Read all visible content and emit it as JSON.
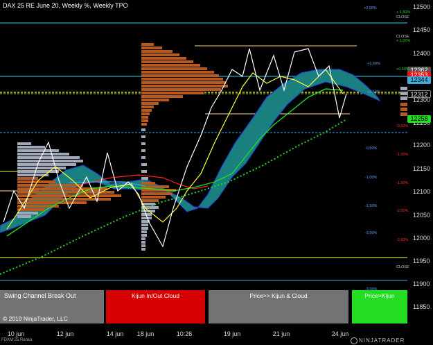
{
  "title": "DAX 25 RE June 20, Weekly %, Weekly TPO",
  "y_axis": {
    "ticks": [
      "12500",
      "12450",
      "12400",
      "12350",
      "12300",
      "12250",
      "12200",
      "12150",
      "12100",
      "12050",
      "12000",
      "11950",
      "11900",
      "11850"
    ]
  },
  "x_axis": {
    "ticks": [
      "10 jun",
      "12 jun",
      "14 jun",
      "18 jun",
      "10:26",
      "19 jun",
      "21 jun",
      "24 jun"
    ]
  },
  "price_labels": {
    "red": "12353",
    "blue": "12344",
    "last": "12312",
    "green": "12258",
    "dark": "12362"
  },
  "pct_labels": {
    "p200": "+2,00%",
    "p150": "+ 1,50%",
    "close1": "CLOSE",
    "close2": "CLOSE",
    "p100a": "+ 1,00%",
    "p100b": "+1,00%",
    "p050a": "+0,50%",
    "p050b": "+0,50%",
    "m050a": "-0,50%",
    "m050b": "-0,50%",
    "m100a": "-1,00%",
    "m100b": "-1,00%",
    "m150a": "-1,50%",
    "m150b": "-1,50%",
    "m200a": "-2,00%",
    "m200b": "-2,00%",
    "m250": "-2,50%",
    "close3": "CLOSE",
    "m300": "-3,00%"
  },
  "panels": {
    "swing": "Swing Channel Break Out",
    "kijun": "Kijun In/Out Cloud",
    "price_kijun_cloud": "Price>> Kijun & Cloud",
    "price_kijun": "Price>Kijun"
  },
  "copyright": "© 2019 NinjaTrader, LLC",
  "footer_note": "FDXM 25 Renko",
  "brand": "NINJATRADER",
  "colors": {
    "background": "#000000",
    "cloud": "#1a7f7f",
    "tpo_orange": "#b85a1e",
    "tpo_gray": "#a0a8b8",
    "kijun_yellow": "#ffff33",
    "tenkan_green": "#22dd22",
    "red_line": "#ff2222",
    "cyan_line": "#33aaee"
  }
}
